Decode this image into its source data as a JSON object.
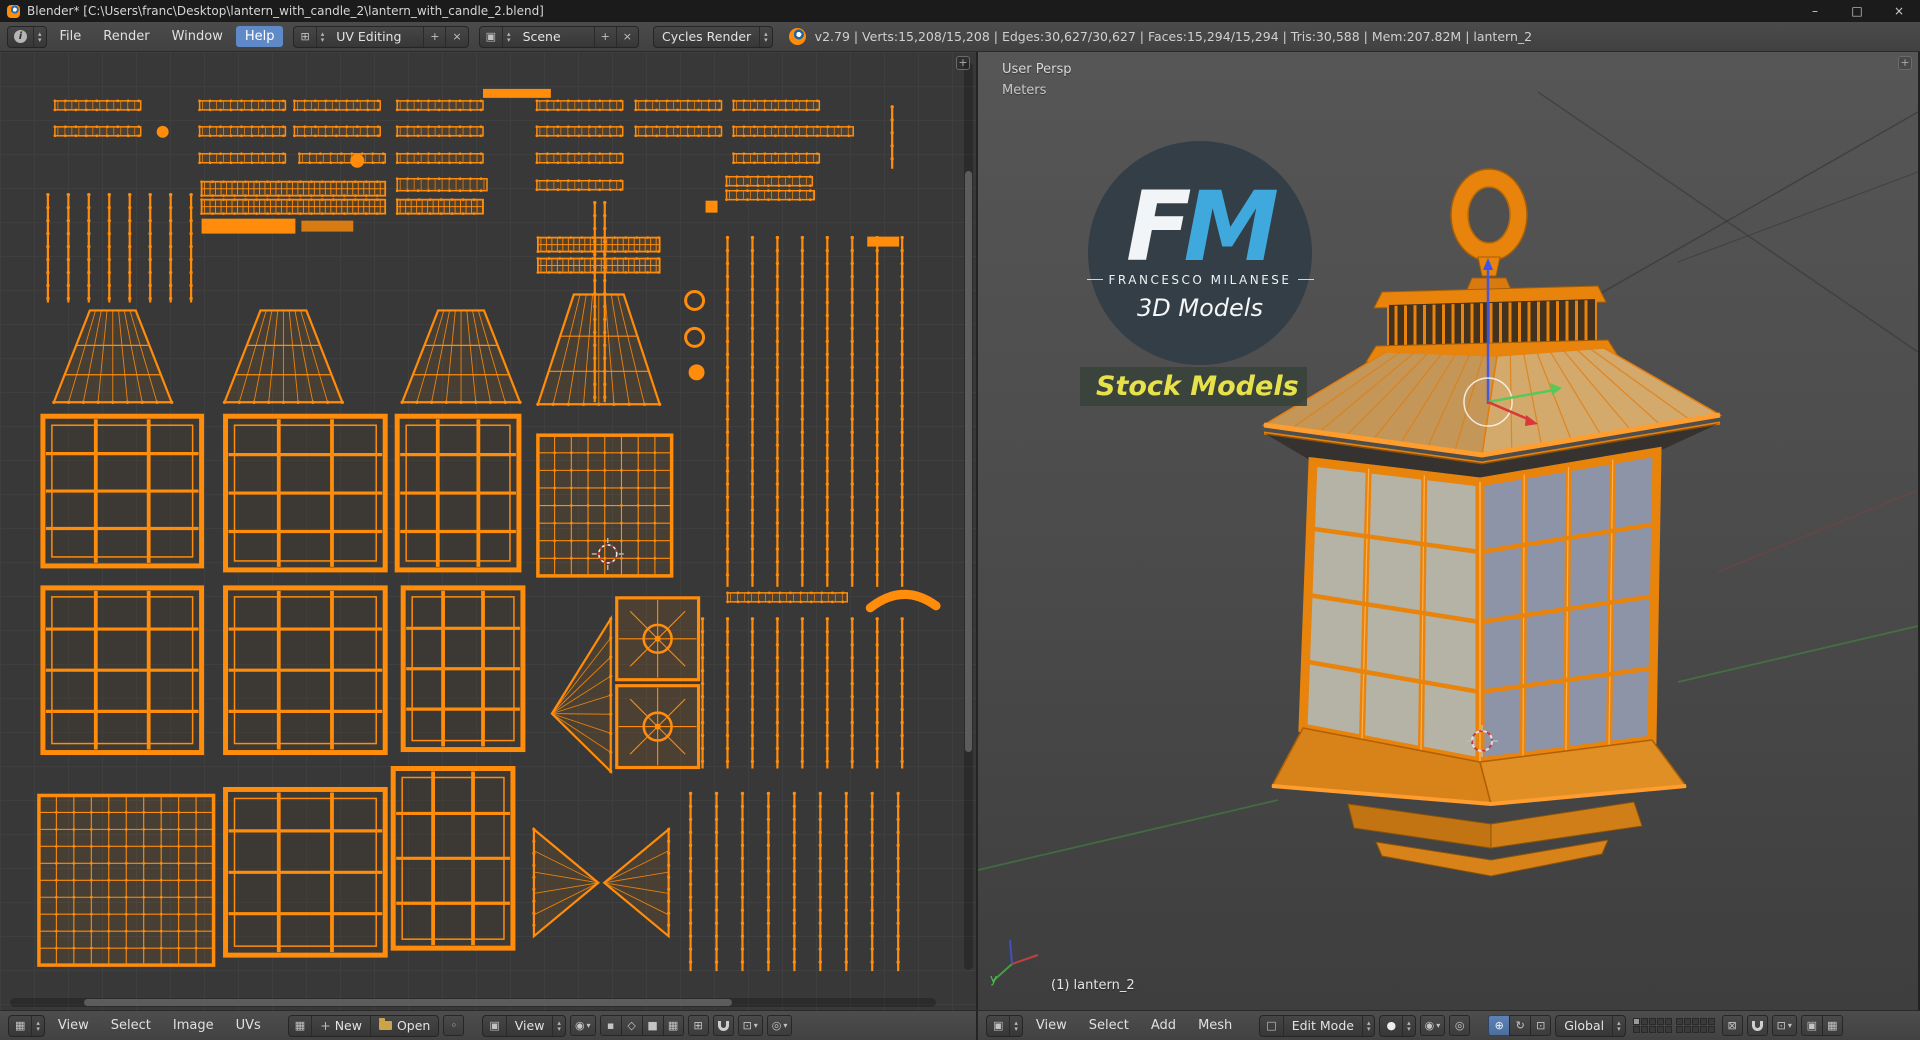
{
  "window": {
    "title": "Blender* [C:\\Users\\franc\\Desktop\\lantern_with_candle_2\\lantern_with_candle_2.blend]"
  },
  "icons": {
    "minimize": "–",
    "maximize": "□",
    "close": "×",
    "info": "i",
    "up": "▴",
    "down": "▾",
    "dropdown": "▾",
    "grid": "⊞",
    "plus": "+",
    "x_small": "×",
    "scene": "▣",
    "image": "▦",
    "cube": "□",
    "sphere": "●",
    "pivot": "◉",
    "proportional": "◎",
    "pin": "◦",
    "vertex_mode": "▪",
    "edge_mode": "◇",
    "face_mode": "■",
    "island_mode": "▦",
    "translate": "⊕",
    "rotate": "↻",
    "scale": "⊡",
    "axis": "⊠",
    "snap_element": "⊡",
    "render_still": "▣",
    "render_anim": "▦",
    "lock": "⊠",
    "corner": "+"
  },
  "header": {
    "menus": {
      "file": "File",
      "render": "Render",
      "window": "Window",
      "help": "Help"
    },
    "layout_name": "UV Editing",
    "scene_name": "Scene",
    "engine_name": "Cycles Render",
    "stats": "v2.79 | Verts:15,208/15,208 | Edges:30,627/30,627 | Faces:15,294/15,294 | Tris:30,588 | Mem:207.82M | lantern_2"
  },
  "uv_footer": {
    "menus": {
      "view": "View",
      "select": "Select",
      "image": "Image",
      "uvs": "UVs"
    },
    "new_label": "New",
    "open_label": "Open",
    "view_dropdown_label": "View"
  },
  "v3d_footer": {
    "menus": {
      "view": "View",
      "select": "Select",
      "add": "Add",
      "mesh": "Mesh"
    },
    "mode_label": "Edit Mode",
    "orientation_label": "Global"
  },
  "viewport": {
    "view_name": "User Persp",
    "units": "Meters",
    "object_info": "(1) lantern_2",
    "axis_y": "y"
  },
  "logo": {
    "f": "F",
    "m": "M",
    "name": "FRANCESCO MILANESE",
    "subtitle": "3D Models",
    "badge": "Stock Models"
  },
  "colors": {
    "accent": "#ff8c0a",
    "accent_dark": "#e07d12",
    "menu_highlight": "#6089c8",
    "frame": "#e8830c",
    "glass_left": "#b5b2a6",
    "glass_right": "#8e94a8",
    "roof_left": "#c49758",
    "roof_right": "#d4a96c"
  }
}
